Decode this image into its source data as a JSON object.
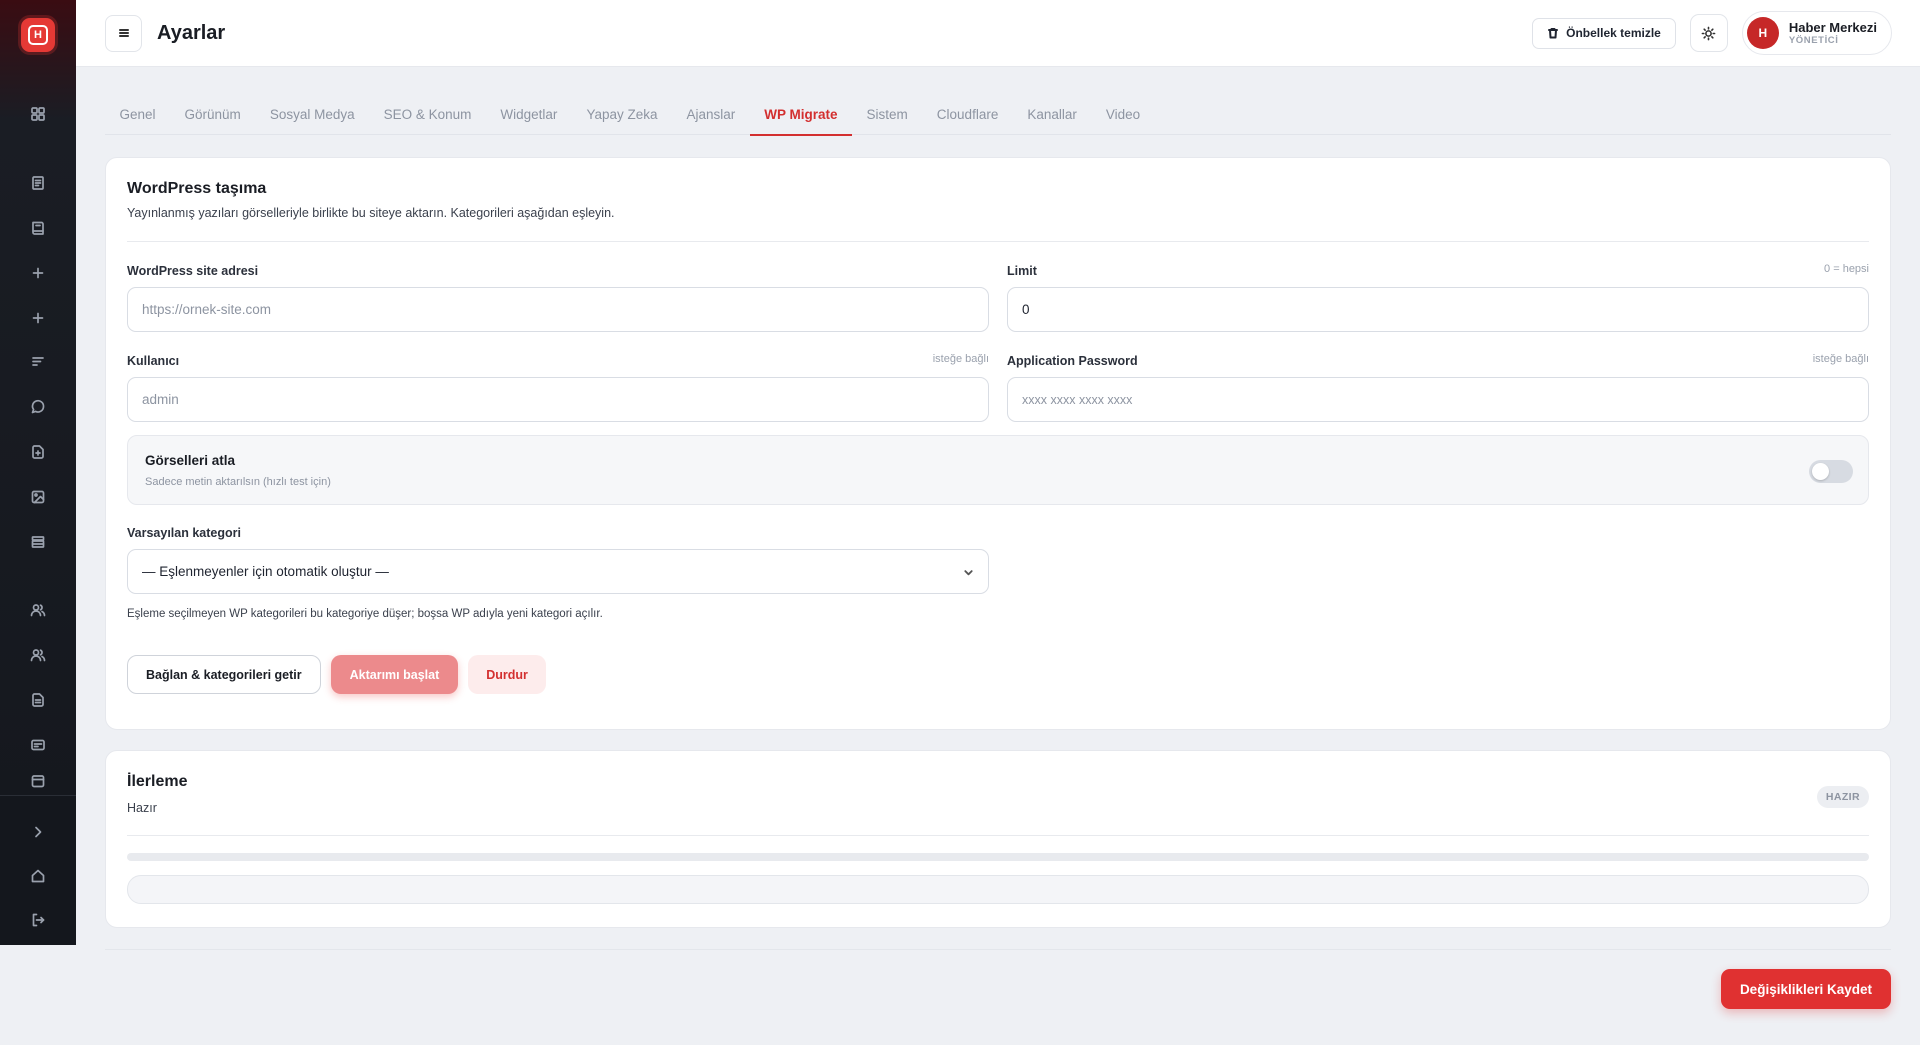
{
  "brand": {
    "logo_letter": "H",
    "accent": "#e53935"
  },
  "sidebar": {
    "items": [
      {
        "icon": "dashboard-icon"
      },
      {
        "icon": "article-icon"
      },
      {
        "icon": "book-icon"
      },
      {
        "icon": "plus-icon"
      },
      {
        "icon": "plus-icon"
      },
      {
        "icon": "list-icon"
      },
      {
        "icon": "comment-icon"
      },
      {
        "icon": "file-plus-icon"
      },
      {
        "icon": "image-icon"
      },
      {
        "icon": "layers-icon"
      },
      {
        "icon": "users-icon"
      },
      {
        "icon": "users-group-icon"
      },
      {
        "icon": "document-icon"
      },
      {
        "icon": "id-card-icon"
      },
      {
        "icon": "calendar-icon"
      }
    ],
    "bottom": [
      {
        "icon": "chevron-right-icon"
      },
      {
        "icon": "home-icon"
      },
      {
        "icon": "logout-icon"
      }
    ]
  },
  "header": {
    "title": "Ayarlar",
    "cache_button": "Önbellek temizle",
    "user": {
      "initial": "H",
      "name": "Haber Merkezi",
      "role": "YÖNETİCİ"
    }
  },
  "tabs": [
    {
      "label": "Genel",
      "active": false
    },
    {
      "label": "Görünüm",
      "active": false
    },
    {
      "label": "Sosyal Medya",
      "active": false
    },
    {
      "label": "SEO & Konum",
      "active": false
    },
    {
      "label": "Widgetlar",
      "active": false
    },
    {
      "label": "Yapay Zeka",
      "active": false
    },
    {
      "label": "Ajanslar",
      "active": false
    },
    {
      "label": "WP Migrate",
      "active": true
    },
    {
      "label": "Sistem",
      "active": false
    },
    {
      "label": "Cloudflare",
      "active": false
    },
    {
      "label": "Kanallar",
      "active": false
    },
    {
      "label": "Video",
      "active": false
    }
  ],
  "migration": {
    "title": "WordPress taşıma",
    "subtitle": "Yayınlanmış yazıları görselleriyle birlikte bu siteye aktarın. Kategorileri aşağıdan eşleyin.",
    "site_url": {
      "label": "WordPress site adresi",
      "placeholder": "https://ornek-site.com"
    },
    "limit": {
      "label": "Limit",
      "hint": "0 = hepsi",
      "value": "0"
    },
    "user": {
      "label": "Kullanıcı",
      "hint": "isteğe bağlı",
      "placeholder": "admin"
    },
    "app_password": {
      "label": "Application Password",
      "hint": "isteğe bağlı",
      "placeholder": "xxxx xxxx xxxx xxxx"
    },
    "skip_images": {
      "title": "Görselleri atla",
      "description": "Sadece metin aktarılsın (hızlı test için)",
      "enabled": false
    },
    "default_category": {
      "label": "Varsayılan kategori",
      "value": "— Eşlenmeyenler için otomatik oluştur —"
    },
    "help": "Eşleme seçilmeyen WP kategorileri bu kategoriye düşer; boşsa WP adıyla yeni kategori açılır.",
    "buttons": {
      "connect": "Bağlan & kategorileri getir",
      "start": "Aktarımı başlat",
      "stop": "Durdur"
    }
  },
  "progress": {
    "title": "İlerleme",
    "status_text": "Hazır",
    "badge": "HAZIR",
    "percent": 0
  },
  "footer": {
    "save_button": "Değişiklikleri Kaydet"
  }
}
